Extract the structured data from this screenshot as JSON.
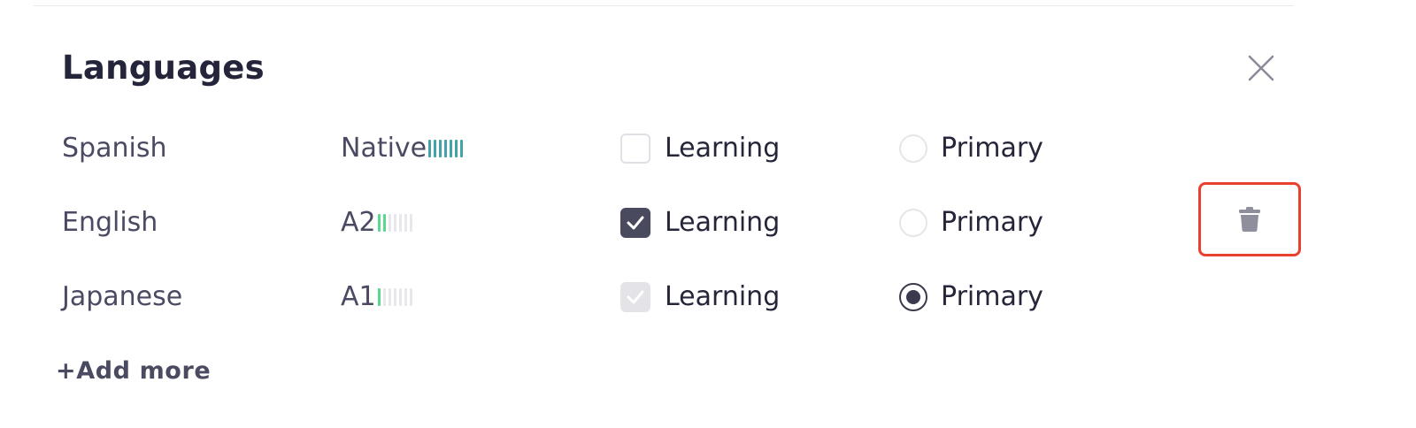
{
  "title": "Languages",
  "languages": [
    {
      "name": "Spanish",
      "level": "Native",
      "level_bars_filled": 7,
      "level_bars_total": 7,
      "is_native": true,
      "learning_label": "Learning",
      "learning_state": "unchecked",
      "primary_label": "Primary",
      "primary_selected": false
    },
    {
      "name": "English",
      "level": "A2",
      "level_bars_filled": 2,
      "level_bars_total": 7,
      "is_native": false,
      "learning_label": "Learning",
      "learning_state": "checked",
      "primary_label": "Primary",
      "primary_selected": false
    },
    {
      "name": "Japanese",
      "level": "A1",
      "level_bars_filled": 1,
      "level_bars_total": 7,
      "is_native": false,
      "learning_label": "Learning",
      "learning_state": "disabled-checked",
      "primary_label": "Primary",
      "primary_selected": true
    }
  ],
  "add_more_label": "+Add more",
  "icons": {
    "close": "close-icon",
    "checkmark": "checkmark-icon",
    "delete": "trash-icon"
  },
  "colors": {
    "native_bar": "#43a4a8",
    "level_bar": "#57d98e",
    "empty_bar": "#e7e7ec",
    "checked_box": "#4a4a5f",
    "highlight_border": "#e8412e",
    "trash": "#8e8e9c"
  }
}
